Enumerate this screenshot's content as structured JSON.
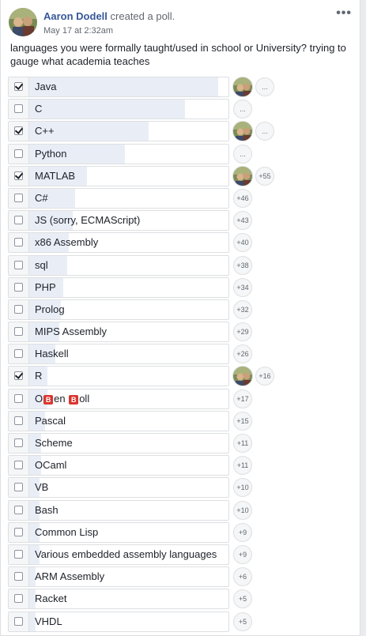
{
  "post": {
    "author": "Aaron Dodell",
    "action": "created a poll.",
    "timestamp": "May 17 at 2:32am",
    "question": "languages you were formally taught/used in school or University? trying to gauge what academia teaches",
    "more_label": "•••"
  },
  "poll": {
    "options": [
      {
        "label": "Java",
        "checked": true,
        "bar": 0.95,
        "voter": true,
        "badge": "..."
      },
      {
        "label": "C",
        "checked": false,
        "bar": 0.78,
        "voter": false,
        "badge": "..."
      },
      {
        "label": "C++",
        "checked": true,
        "bar": 0.6,
        "voter": true,
        "badge": "..."
      },
      {
        "label": "Python",
        "checked": false,
        "bar": 0.48,
        "voter": false,
        "badge": "..."
      },
      {
        "label": "MATLAB",
        "checked": true,
        "bar": 0.29,
        "voter": true,
        "badge": "+55"
      },
      {
        "label": "C#",
        "checked": false,
        "bar": 0.23,
        "voter": false,
        "badge": "+46"
      },
      {
        "label": "JS (sorry, ECMAScript)",
        "checked": false,
        "bar": 0.22,
        "voter": false,
        "badge": "+43"
      },
      {
        "label": "x86 Assembly",
        "checked": false,
        "bar": 0.2,
        "voter": false,
        "badge": "+40"
      },
      {
        "label": "sql",
        "checked": false,
        "bar": 0.19,
        "voter": false,
        "badge": "+38"
      },
      {
        "label": "PHP",
        "checked": false,
        "bar": 0.17,
        "voter": false,
        "badge": "+34"
      },
      {
        "label": "Prolog",
        "checked": false,
        "bar": 0.16,
        "voter": false,
        "badge": "+32"
      },
      {
        "label": "MIPS Assembly",
        "checked": false,
        "bar": 0.15,
        "voter": false,
        "badge": "+29"
      },
      {
        "label": "Haskell",
        "checked": false,
        "bar": 0.13,
        "voter": false,
        "badge": "+26"
      },
      {
        "label": "R",
        "checked": true,
        "bar": 0.09,
        "voter": true,
        "badge": "+16"
      },
      {
        "label": "O🅱en 🅱oll",
        "checked": false,
        "bar": 0.09,
        "voter": false,
        "badge": "+17"
      },
      {
        "label": "Pascal",
        "checked": false,
        "bar": 0.08,
        "voter": false,
        "badge": "+15"
      },
      {
        "label": "Scheme",
        "checked": false,
        "bar": 0.06,
        "voter": false,
        "badge": "+11"
      },
      {
        "label": "OCaml",
        "checked": false,
        "bar": 0.06,
        "voter": false,
        "badge": "+11"
      },
      {
        "label": "VB",
        "checked": false,
        "bar": 0.05,
        "voter": false,
        "badge": "+10"
      },
      {
        "label": "Bash",
        "checked": false,
        "bar": 0.05,
        "voter": false,
        "badge": "+10"
      },
      {
        "label": "Common Lisp",
        "checked": false,
        "bar": 0.05,
        "voter": false,
        "badge": "+9"
      },
      {
        "label": "Various embedded assembly languages",
        "checked": false,
        "bar": 0.05,
        "voter": false,
        "badge": "+9"
      },
      {
        "label": "ARM Assembly",
        "checked": false,
        "bar": 0.03,
        "voter": false,
        "badge": "+6"
      },
      {
        "label": "Racket",
        "checked": false,
        "bar": 0.03,
        "voter": false,
        "badge": "+5"
      },
      {
        "label": "VHDL",
        "checked": false,
        "bar": 0.03,
        "voter": false,
        "badge": "+5"
      }
    ]
  },
  "colors": {
    "author_link": "#365899",
    "bar_fill": "#e9eef6",
    "border": "#dddfe2",
    "badge_bg": "#f5f6f7",
    "b_emoji": "#d9362e"
  }
}
